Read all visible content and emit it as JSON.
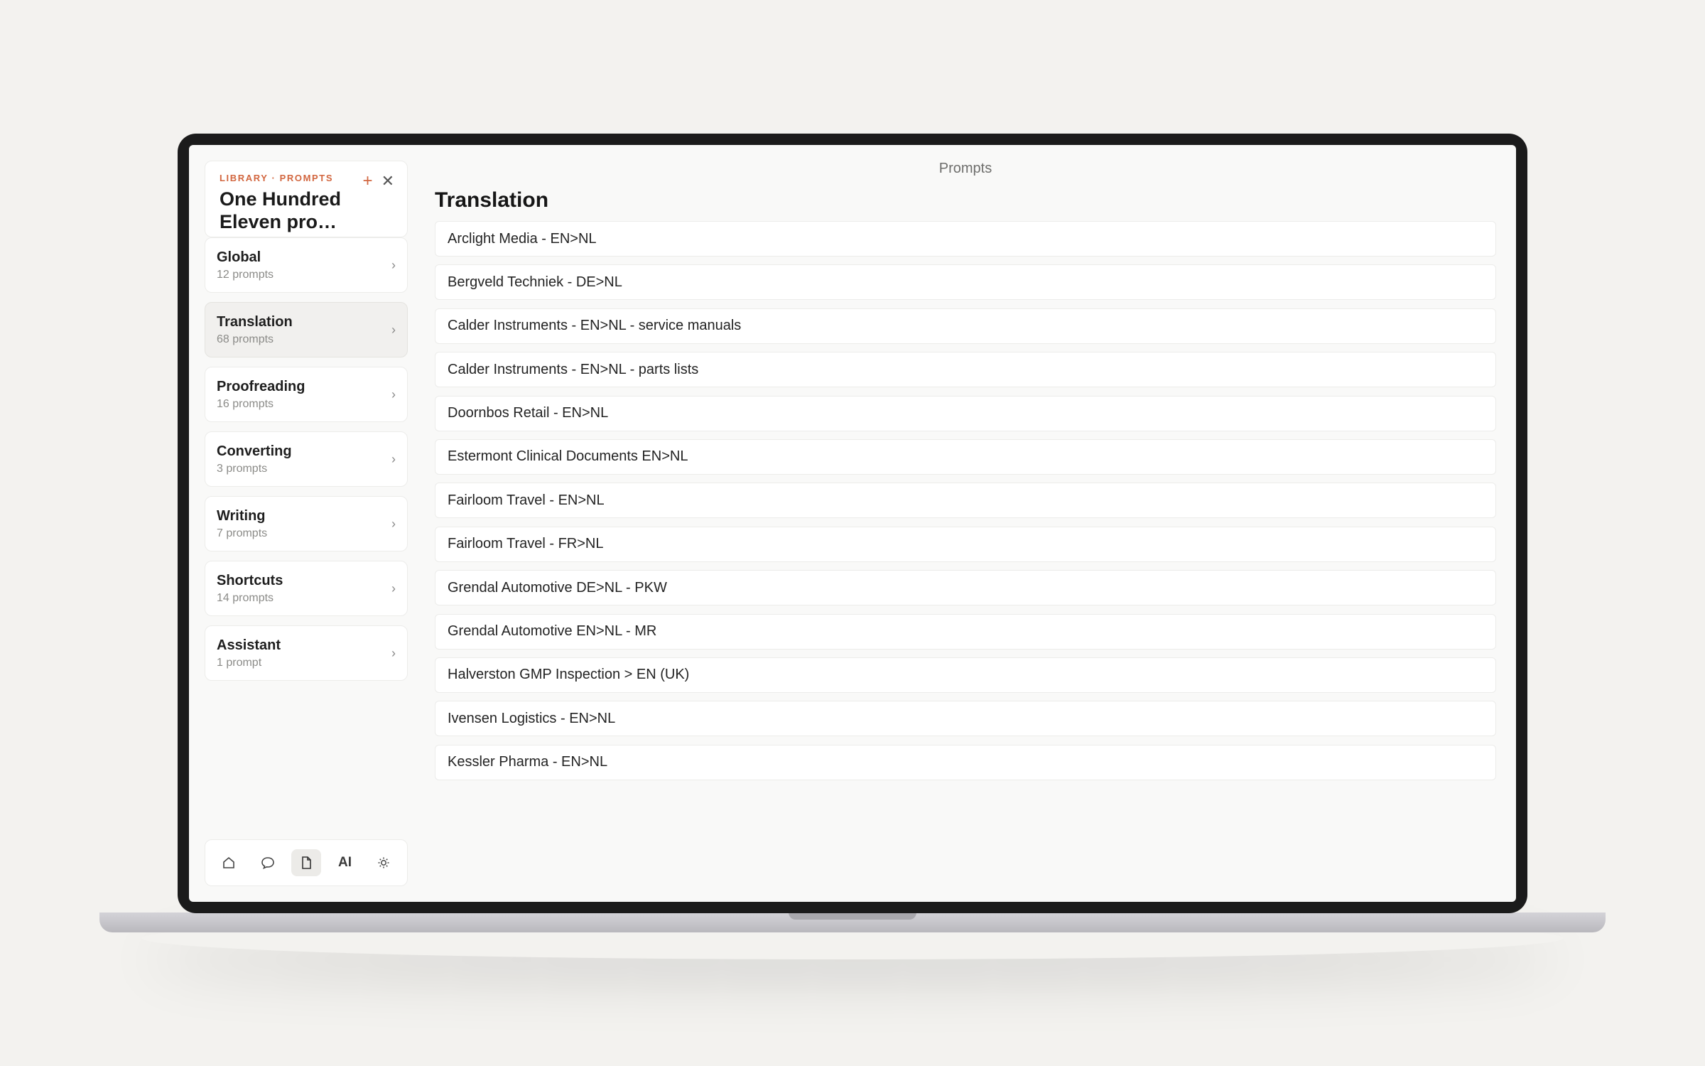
{
  "sidebar": {
    "eyebrow": "LIBRARY · PROMPTS",
    "title": "One Hundred Eleven pro…",
    "add_icon": "plus-icon",
    "close_icon": "close-icon",
    "groups": [
      {
        "name": "Global",
        "count": "12 prompts",
        "active": false
      },
      {
        "name": "Translation",
        "count": "68 prompts",
        "active": true
      },
      {
        "name": "Proofreading",
        "count": "16 prompts",
        "active": false
      },
      {
        "name": "Converting",
        "count": "3 prompts",
        "active": false
      },
      {
        "name": "Writing",
        "count": "7 prompts",
        "active": false
      },
      {
        "name": "Shortcuts",
        "count": "14 prompts",
        "active": false
      },
      {
        "name": "Assistant",
        "count": "1 prompt",
        "active": false
      }
    ],
    "toolbar": {
      "home_icon": "home-icon",
      "chat_icon": "chat-bubble-icon",
      "document_icon": "document-icon",
      "ai_label": "AI",
      "settings_icon": "sun-gear-icon"
    }
  },
  "main": {
    "topbar_title": "Prompts",
    "page_title": "Translation",
    "prompts": [
      "Arclight Media - EN>NL",
      "Bergveld Techniek - DE>NL",
      "Calder Instruments - EN>NL - service manuals",
      "Calder Instruments - EN>NL - parts lists",
      "Doornbos Retail - EN>NL",
      "Estermont Clinical Documents EN>NL",
      "Fairloom Travel - EN>NL",
      "Fairloom Travel - FR>NL",
      "Grendal Automotive DE>NL - PKW",
      "Grendal Automotive EN>NL - MR",
      "Halverston GMP Inspection > EN (UK)",
      "Ivensen Logistics - EN>NL",
      "Kessler Pharma - EN>NL"
    ]
  },
  "colors": {
    "accent": "#d2663f",
    "background": "#f3f2ef",
    "bezel": "#1b1b1b"
  }
}
